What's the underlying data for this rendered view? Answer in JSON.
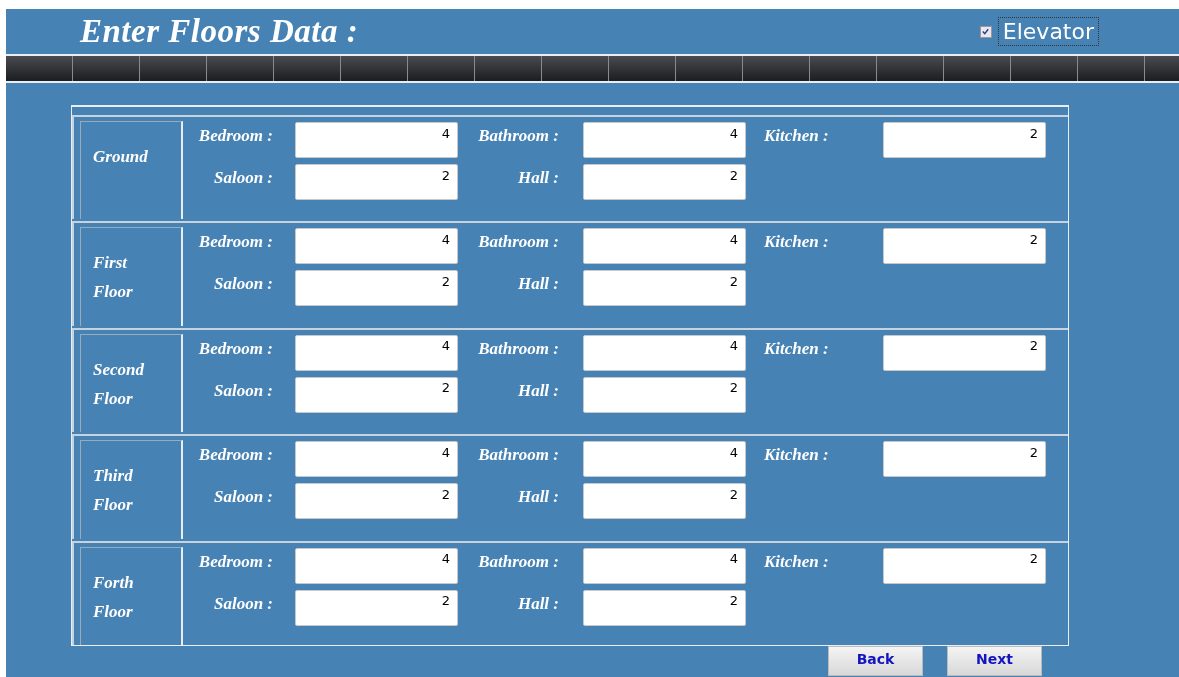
{
  "title": "Enter Floors Data :",
  "elevator": {
    "label": "Elevator",
    "checked": true
  },
  "floors": [
    {
      "name": "Ground",
      "fields": [
        {
          "label": "Bedroom :",
          "value": "4"
        },
        {
          "label": "Bathroom :",
          "value": "4"
        },
        {
          "label": "Kitchen :",
          "value": "2"
        },
        {
          "label": "Saloon :",
          "value": "2"
        },
        {
          "label": "Hall :",
          "value": "2"
        }
      ]
    },
    {
      "name": "First Floor",
      "fields": [
        {
          "label": "Bedroom :",
          "value": "4"
        },
        {
          "label": "Bathroom :",
          "value": "4"
        },
        {
          "label": "Kitchen :",
          "value": "2"
        },
        {
          "label": "Saloon :",
          "value": "2"
        },
        {
          "label": "Hall :",
          "value": "2"
        }
      ]
    },
    {
      "name": "Second Floor",
      "fields": [
        {
          "label": "Bedroom :",
          "value": "4"
        },
        {
          "label": "Bathroom :",
          "value": "4"
        },
        {
          "label": "Kitchen :",
          "value": "2"
        },
        {
          "label": "Saloon :",
          "value": "2"
        },
        {
          "label": "Hall :",
          "value": "2"
        }
      ]
    },
    {
      "name": "Third Floor",
      "fields": [
        {
          "label": "Bedroom :",
          "value": "4"
        },
        {
          "label": "Bathroom :",
          "value": "4"
        },
        {
          "label": "Kitchen :",
          "value": "2"
        },
        {
          "label": "Saloon :",
          "value": "2"
        },
        {
          "label": "Hall :",
          "value": "2"
        }
      ]
    },
    {
      "name": "Forth Floor",
      "fields": [
        {
          "label": "Bedroom :",
          "value": "4"
        },
        {
          "label": "Bathroom :",
          "value": "4"
        },
        {
          "label": "Kitchen :",
          "value": "2"
        },
        {
          "label": "Saloon :",
          "value": "2"
        },
        {
          "label": "Hall :",
          "value": "2"
        }
      ]
    }
  ],
  "buttons": [
    "Back",
    "Next"
  ]
}
